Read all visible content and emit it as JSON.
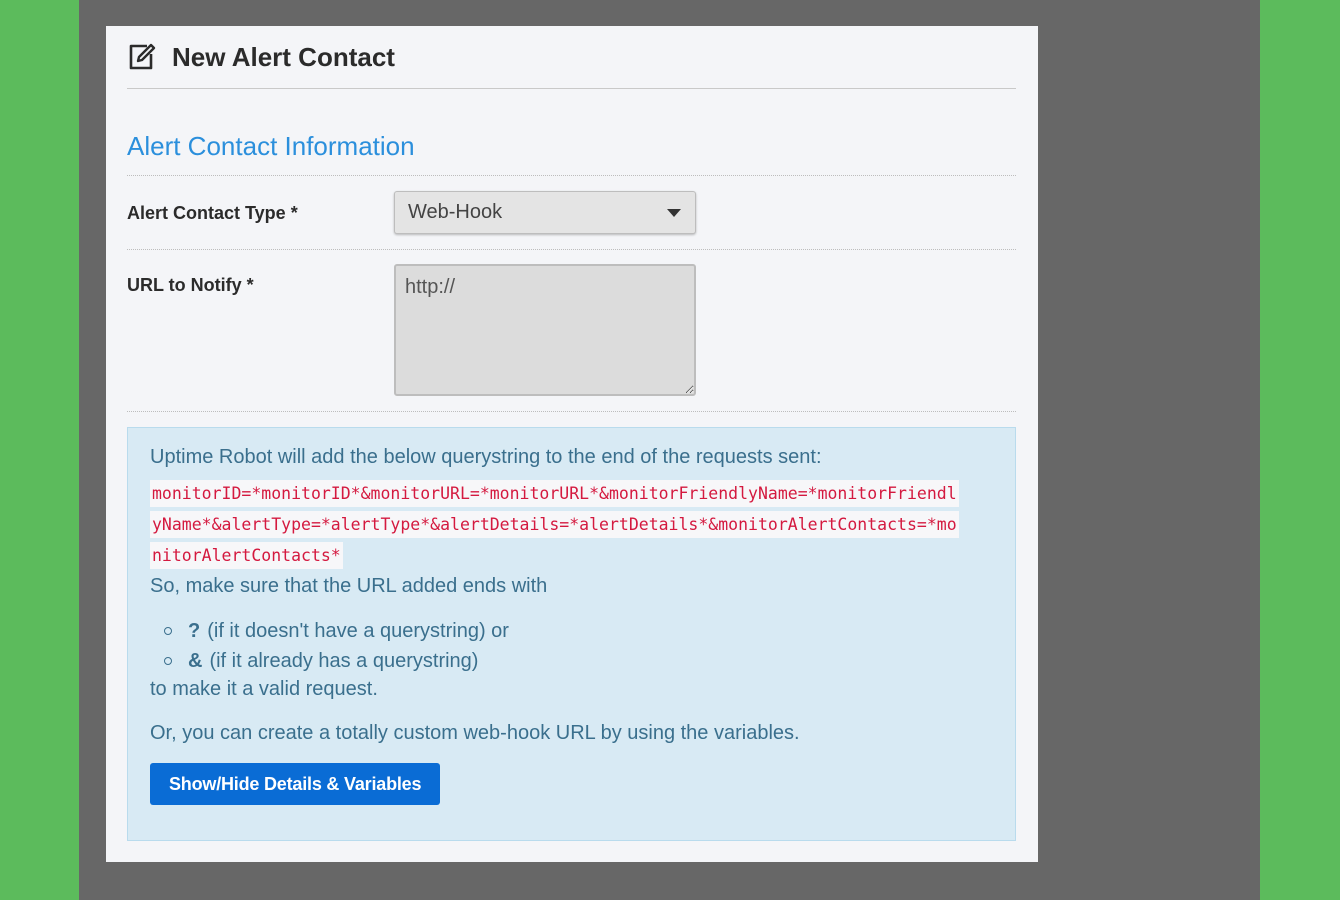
{
  "modal": {
    "title": "New Alert Contact"
  },
  "section": {
    "title": "Alert Contact Information"
  },
  "form": {
    "type_label": "Alert Contact Type *",
    "type_value": "Web-Hook",
    "url_label": "URL to Notify *",
    "url_placeholder": "http://"
  },
  "info": {
    "intro": "Uptime Robot will add the below querystring to the end of the requests sent:",
    "querystring": "monitorID=*monitorID*&monitorURL=*monitorURL*&monitorFriendlyName=*monitorFriendlyName*&alertType=*alertType*&alertDetails=*alertDetails*&monitorAlertContacts=*monitorAlertContacts*",
    "make_sure": "So, make sure that the URL added ends with",
    "bullets": [
      {
        "symbol": "?",
        "text": "(if it doesn't have a querystring) or"
      },
      {
        "symbol": "&",
        "text": "(if it already has a querystring)"
      }
    ],
    "valid_request": "to make it a valid request.",
    "custom": "Or, you can create a totally custom web-hook URL by using the variables.",
    "button_label": "Show/Hide Details & Variables"
  },
  "icons": {
    "header": "edit-icon",
    "select": "caret-down-icon"
  },
  "colors": {
    "accent": "#2b8fdc",
    "button": "#0a6cd5",
    "code": "#d4193f",
    "info_bg": "#d8eaf4"
  }
}
